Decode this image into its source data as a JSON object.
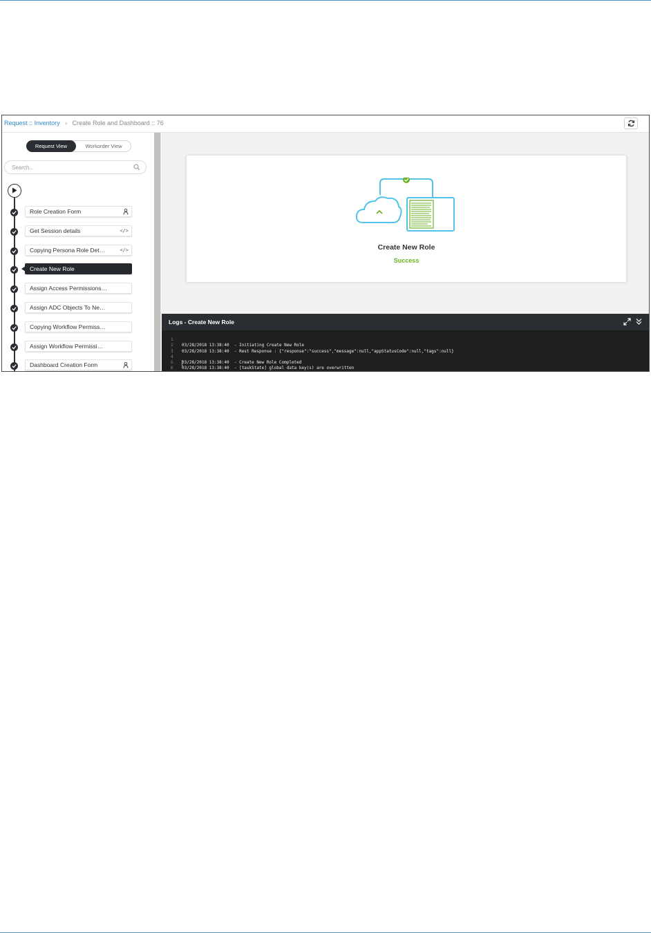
{
  "breadcrumb": {
    "request": "Request",
    "separator1": "::",
    "inventory": "Inventory",
    "current": "Create Role and Dashboard :: 76"
  },
  "sidebar": {
    "view_toggle": {
      "active": "Request View",
      "inactive": "Workorder View"
    },
    "search": {
      "placeholder": "Search..."
    },
    "steps": [
      {
        "label": "Role Creation Form",
        "type_icon": "user-task-icon"
      },
      {
        "label": "Get Session details",
        "type_icon": "code-icon"
      },
      {
        "label": "Copying Persona Role Det…",
        "type_icon": "code-icon"
      },
      {
        "label": "Create New Role",
        "type_icon": "",
        "active": true
      },
      {
        "label": "Assign Access Permissions…",
        "type_icon": ""
      },
      {
        "label": "Assign ADC Objects To Ne…",
        "type_icon": ""
      },
      {
        "label": "Copying Workflow Permiss…",
        "type_icon": ""
      },
      {
        "label": "Assign Workflow Permissi…",
        "type_icon": ""
      },
      {
        "label": "Dashboard Creation Form",
        "type_icon": "user-task-icon"
      }
    ]
  },
  "main": {
    "task_title": "Create New Role",
    "task_status": "Success",
    "status_color": "#6ab023"
  },
  "logs": {
    "title": "Logs - Create New Role",
    "lines": [
      {
        "num": "1",
        "text": "03/28/2018 13:38:40  - Initiating Create New Role"
      },
      {
        "num": "2",
        "text": "03/28/2018 13:38:40  - Rest Response : {\"response\":\"success\",\"message\":null,\"appStatusCode\":null,\"tags\":null}"
      },
      {
        "num": "3",
        "text": ""
      },
      {
        "num": "4",
        "text": "03/28/2018 13:38:40  - Create New Role Completed"
      },
      {
        "num": "5",
        "text": "03/28/2018 13:38:40  - [taskState] global data key(s) are overwritten"
      },
      {
        "num": "6",
        "text": ""
      }
    ]
  },
  "colors": {
    "link": "#2e8bc9",
    "dark": "#25292e",
    "success": "#6ab023",
    "illustration_blue": "#4fc3e8"
  }
}
